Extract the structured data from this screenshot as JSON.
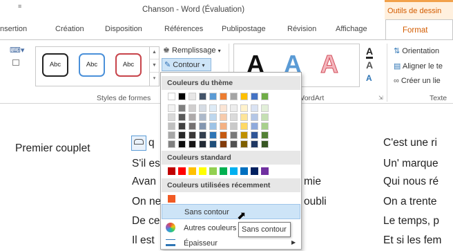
{
  "window": {
    "title": "Chanson - Word (Évaluation)",
    "context_tab_group": "Outils de dessin"
  },
  "tabs": [
    "nsertion",
    "Création",
    "Disposition",
    "Références",
    "Publipostage",
    "Révision",
    "Affichage",
    "Format"
  ],
  "ribbon": {
    "shape_styles": {
      "items": [
        "Abc",
        "Abc",
        "Abc"
      ],
      "border_colors": [
        "#222222",
        "#4a90d9",
        "#c7434a"
      ],
      "label": "Styles de formes"
    },
    "fill_label": "Remplissage",
    "outline_label": "Contour",
    "wordart": {
      "letters": [
        "A",
        "A",
        "A"
      ],
      "label": "WordArt"
    },
    "text_controls": [
      "A",
      "A",
      "A"
    ],
    "text_group": {
      "orientation": "Orientation",
      "align": "Aligner le te",
      "create_link": "Créer un lie",
      "label": "Texte"
    }
  },
  "menu": {
    "theme_header": "Couleurs du thème",
    "theme_colors": [
      [
        "#ffffff",
        "#f2f2f2",
        "#d9d9d9",
        "#bfbfbf",
        "#a6a6a6",
        "#808080"
      ],
      [
        "#000000",
        "#7f7f7f",
        "#595959",
        "#404040",
        "#262626",
        "#0d0d0d"
      ],
      [
        "#e7e6e6",
        "#d0cece",
        "#aeaaaa",
        "#757171",
        "#3a3838",
        "#171616"
      ],
      [
        "#44546a",
        "#d6dce4",
        "#adb9ca",
        "#8497b0",
        "#333f4f",
        "#222a35"
      ],
      [
        "#5b9bd5",
        "#deebf6",
        "#bdd7ee",
        "#9dc3e6",
        "#2e75b5",
        "#1f4e79"
      ],
      [
        "#ed7d31",
        "#fbe5d5",
        "#f7cbac",
        "#f4b183",
        "#c55a11",
        "#833c0b"
      ],
      [
        "#a5a5a5",
        "#ededed",
        "#dbdbdb",
        "#c9c9c9",
        "#7b7b7b",
        "#525252"
      ],
      [
        "#ffc000",
        "#fff2cc",
        "#fee599",
        "#ffd965",
        "#bf9000",
        "#7f6000"
      ],
      [
        "#4472c4",
        "#dae3f3",
        "#b4c7e7",
        "#8faadc",
        "#2f5597",
        "#1f3864"
      ],
      [
        "#70ad47",
        "#e2efd9",
        "#c5e0b3",
        "#a8d08d",
        "#538135",
        "#375623"
      ]
    ],
    "standard_header": "Couleurs standard",
    "standard_colors": [
      "#c00000",
      "#ff0000",
      "#ffc000",
      "#ffff00",
      "#92d050",
      "#00b050",
      "#00b0f0",
      "#0070c0",
      "#002060",
      "#7030a0"
    ],
    "recent_header": "Couleurs utilisées récemment",
    "recent_colors": [
      "#f15a24"
    ],
    "no_outline": "Sans contour",
    "more_colors": "Autres couleurs",
    "weight": "Épaisseur"
  },
  "tooltip": "Sans contour",
  "document": {
    "heading": "Premier couplet",
    "col1": [
      "q",
      "S'il es",
      "Avan",
      "On ne",
      "De ce",
      "Il est"
    ],
    "col1b": [
      "mie",
      "oubli"
    ],
    "col2": [
      "C'est une ri",
      "Un' marque",
      "Qui nous ré",
      "On a trente",
      "Le temps, p",
      "Et si les fem"
    ]
  }
}
